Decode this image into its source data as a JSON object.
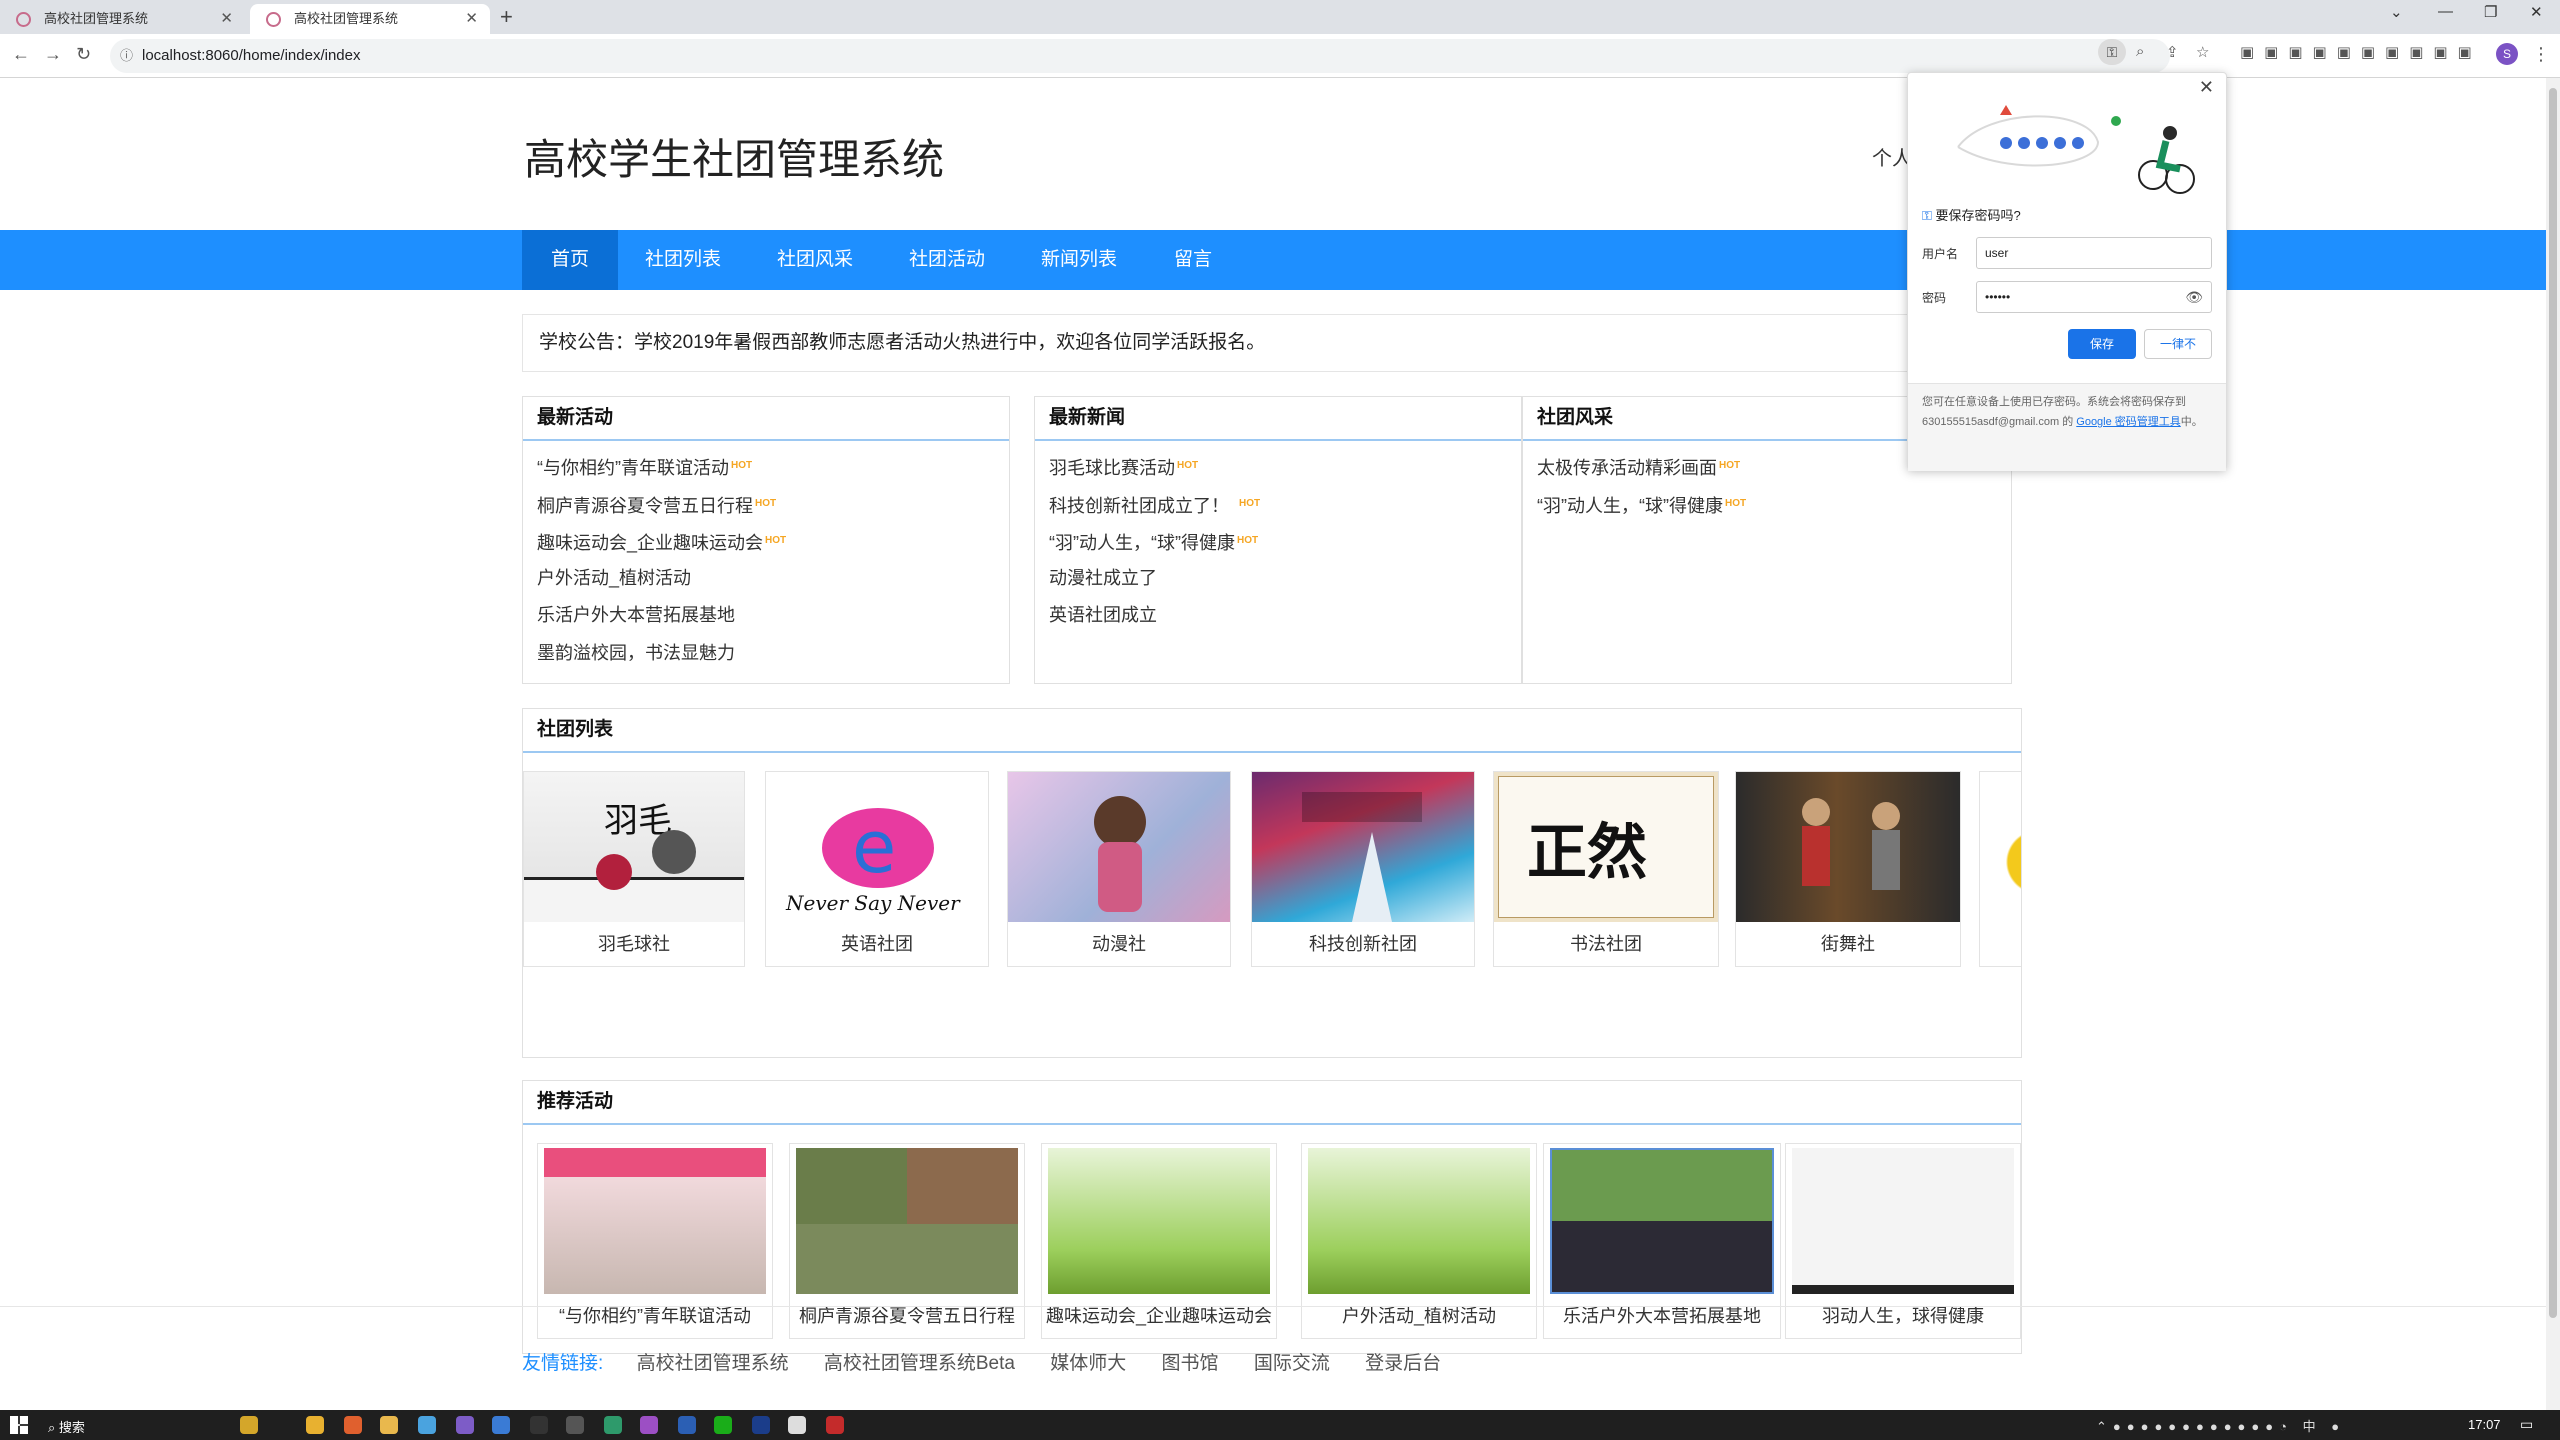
{
  "browser": {
    "tabs": [
      {
        "title": "高校社团管理系统"
      },
      {
        "title": "高校社团管理系统"
      }
    ],
    "url": "localhost:8060/home/index/index",
    "profile_initial": "S"
  },
  "site": {
    "title": "高校学生社团管理系统",
    "personal_link": "个人",
    "nav": [
      "首页",
      "社团列表",
      "社团风采",
      "社团活动",
      "新闻列表",
      "留言"
    ],
    "notice": "学校公告：学校2019年暑假西部教师志愿者活动火热进行中，欢迎各位同学活跃报名。"
  },
  "panels": {
    "latest_activities": {
      "title": "最新活动",
      "items": [
        {
          "text": "“与你相约”青年联谊活动",
          "hot": true
        },
        {
          "text": "桐庐青源谷夏令营五日行程",
          "hot": true
        },
        {
          "text": "趣味运动会_企业趣味运动会",
          "hot": true
        },
        {
          "text": "户外活动_植树活动",
          "hot": false
        },
        {
          "text": "乐活户外大本营拓展基地",
          "hot": false
        },
        {
          "text": "墨韵溢校园，书法显魅力",
          "hot": false
        }
      ]
    },
    "latest_news": {
      "title": "最新新闻",
      "items": [
        {
          "text": "羽毛球比赛活动",
          "hot": true
        },
        {
          "text": "科技创新社团成立了！",
          "hot": true
        },
        {
          "text": "“羽”动人生，“球”得健康",
          "hot": true
        },
        {
          "text": "动漫社成立了",
          "hot": false
        },
        {
          "text": "英语社团成立",
          "hot": false
        }
      ]
    },
    "club_style": {
      "title": "社团风采",
      "items": [
        {
          "text": "太极传承活动精彩画面",
          "hot": true
        },
        {
          "text": "“羽”动人生，“球”得健康",
          "hot": true
        }
      ]
    },
    "hot_label": "HOT"
  },
  "club_list": {
    "title": "社团列表",
    "clubs": [
      "羽毛球社",
      "英语社团",
      "动漫社",
      "科技创新社团",
      "书法社团",
      "街舞社"
    ]
  },
  "recommended": {
    "title": "推荐活动",
    "items": [
      "“与你相约”青年联谊活动",
      "桐庐青源谷夏令营五日行程",
      "趣味运动会_企业趣味运动会",
      "户外活动_植树活动",
      "乐活户外大本营拓展基地",
      "羽动人生，球得健康"
    ]
  },
  "footer": {
    "label": "友情链接:",
    "links": [
      "高校社团管理系统",
      "高校社团管理系统Beta",
      "媒体师大",
      "图书馆",
      "国际交流",
      "登录后台"
    ]
  },
  "password_popup": {
    "title": "要保存密码吗?",
    "username_label": "用户名",
    "username_value": "user",
    "password_label": "密码",
    "password_value": "••••••",
    "save_label": "保存",
    "never_label": "一律不",
    "footer_text": "您可在任意设备上使用已存密码。系统会将密码保存到 630155515asdf@gmail.com 的 ",
    "footer_link": "Google 密码管理工具",
    "footer_suffix": "中。"
  },
  "taskbar": {
    "search_label": "搜索",
    "ime": "中",
    "time": "17:07"
  },
  "colors": {
    "nav_blue": "#1e8fff",
    "nav_active": "#0b6fd6",
    "hot": "#f5a623",
    "chrome_blue": "#1a73e8"
  }
}
